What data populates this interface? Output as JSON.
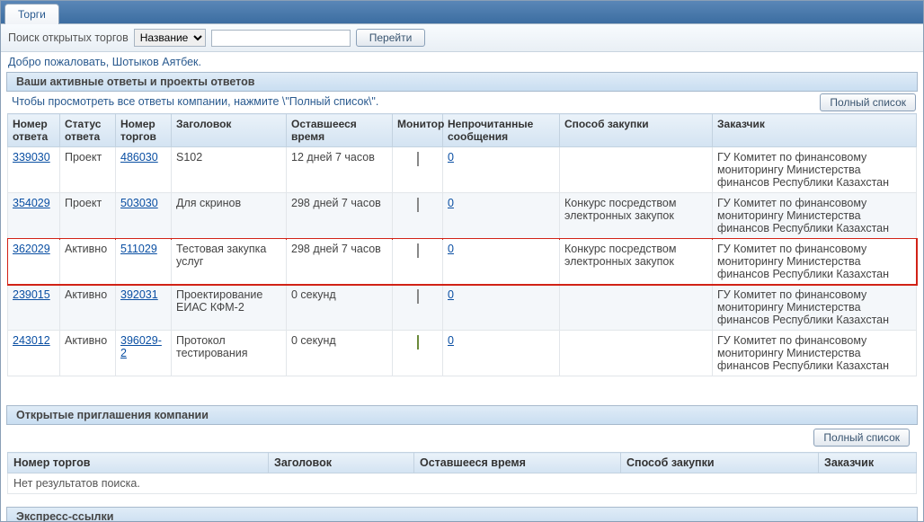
{
  "tab": {
    "label": "Торги"
  },
  "search": {
    "label": "Поиск открытых торгов",
    "select_default": "Название",
    "go_button": "Перейти",
    "input_value": ""
  },
  "welcome": "Добро пожаловать, Шотыков Аятбек.",
  "active": {
    "header": "Ваши активные ответы и проекты ответов",
    "hint": "Чтобы просмотреть все ответы компании, нажмите \\\"Полный список\\\".",
    "full_list_btn": "Полный список",
    "columns": {
      "resp_num": "Номер ответа",
      "resp_status": "Статус ответа",
      "torg_num": "Номер торгов",
      "title": "Заголовок",
      "time_left": "Оставшееся время",
      "monitor": "Монитор",
      "unread": "Непрочитанные сообщения",
      "method": "Способ закупки",
      "customer": "Заказчик"
    },
    "rows": [
      {
        "resp_num": "339030",
        "resp_status": "Проект",
        "torg_num": "486030",
        "title": "S102",
        "time_left": "12 дней 7 часов",
        "monitor_kind": "grid",
        "unread": "0",
        "method": "",
        "customer": "ГУ Комитет по финансовому мониторингу Министерства финансов Республики Казахстан"
      },
      {
        "resp_num": "354029",
        "resp_status": "Проект",
        "torg_num": "503030",
        "title": "Для скринов",
        "time_left": "298 дней 7 часов",
        "monitor_kind": "grid",
        "unread": "0",
        "method": "Конкурс посредством электронных закупок",
        "customer": "ГУ Комитет по финансовому мониторингу Министерства финансов Республики Казахстан"
      },
      {
        "resp_num": "362029",
        "resp_status": "Активно",
        "torg_num": "511029",
        "title": "Тестовая закупка услуг",
        "time_left": "298 дней 7 часов",
        "monitor_kind": "grid",
        "unread": "0",
        "method": "Конкурс посредством электронных закупок",
        "customer": "ГУ Комитет по финансовому мониторингу Министерства финансов Республики Казахстан",
        "highlight": true
      },
      {
        "resp_num": "239015",
        "resp_status": "Активно",
        "torg_num": "392031",
        "title": "Проектирование ЕИАС КФМ-2",
        "time_left": "0 секунд",
        "monitor_kind": "grid",
        "unread": "0",
        "method": "",
        "customer": "ГУ Комитет по финансовому мониторингу Министерства финансов Республики Казахстан"
      },
      {
        "resp_num": "243012",
        "resp_status": "Активно",
        "torg_num": "396029-2",
        "title": "Протокол тестирования",
        "time_left": "0 секунд",
        "monitor_kind": "grid-alt",
        "unread": "0",
        "method": "",
        "customer": "ГУ Комитет по финансовому мониторингу Министерства финансов Республики Казахстан"
      }
    ]
  },
  "open_inv": {
    "header": "Открытые приглашения компании",
    "full_list_btn": "Полный список",
    "columns": {
      "torg_num": "Номер торгов",
      "title": "Заголовок",
      "time_left": "Оставшееся время",
      "method": "Способ закупки",
      "customer": "Заказчик"
    },
    "no_results": "Нет результатов поиска."
  },
  "express": {
    "header": "Экспресс-ссылки"
  }
}
